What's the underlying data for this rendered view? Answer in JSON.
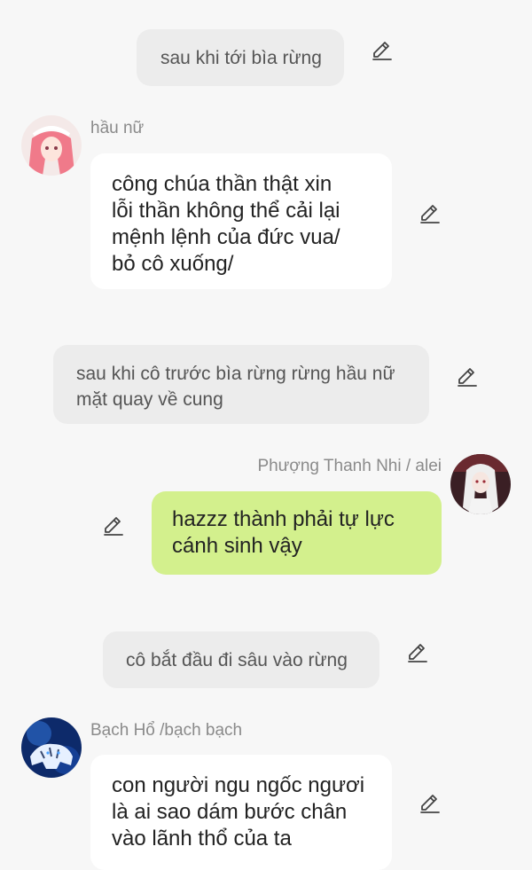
{
  "messages": [
    {
      "type": "narration",
      "text": "sau khi tới bìa rừng"
    },
    {
      "type": "character",
      "sender": "hầu nữ",
      "avatar": "pink-hair-maid-avatar",
      "text": "công chúa thần thật xin\nlỗi thần không thể cải lại\nmệnh lệnh của đức vua/\nbỏ cô xuống/"
    },
    {
      "type": "narration",
      "text": "sau khi cô trước bìa rừng rừng hầu nữ\nmặt quay về cung"
    },
    {
      "type": "user",
      "sender": "Phượng Thanh Nhi / alei",
      "avatar": "white-hair-girl-avatar",
      "text": "hazzz thành phải tự lực\ncánh sinh vậy"
    },
    {
      "type": "narration",
      "text": "cô bắt đầu đi sâu vào rừng"
    },
    {
      "type": "character",
      "sender": "Bạch Hổ /bạch bạch",
      "avatar": "white-tiger-avatar",
      "text": "con người ngu ngốc ngươi\nlà ai sao dám bước chân\nvào lãnh thổ của ta"
    }
  ],
  "colors": {
    "background": "#f7f7f7",
    "narration_bubble": "#ececec",
    "character_bubble": "#ffffff",
    "user_bubble": "#d3f08d",
    "name_text": "#8a8a8a"
  },
  "icons": {
    "edit": "pencil-edit-icon"
  }
}
